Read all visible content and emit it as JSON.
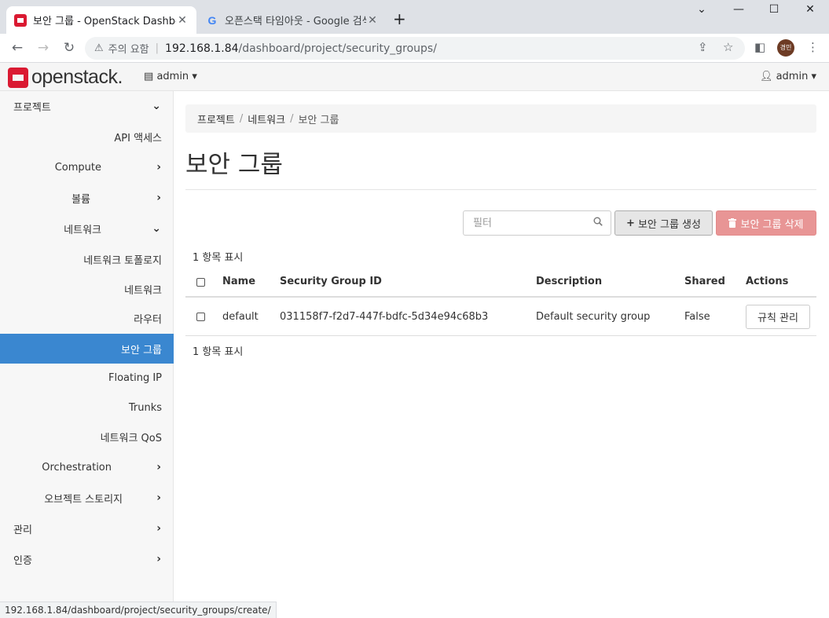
{
  "browser": {
    "tabs": [
      {
        "title": "보안 그룹 - OpenStack Dashboard",
        "active": true
      },
      {
        "title": "오픈스택 타임아웃 - Google 검색",
        "active": false
      }
    ],
    "security_warning": "주의 요함",
    "url_host": "192.168.1.84",
    "url_path": "/dashboard/project/security_groups/",
    "profile_initials": "경민",
    "status_url": "192.168.1.84/dashboard/project/security_groups/create/"
  },
  "header": {
    "logo_text": "openstack.",
    "project_dropdown": "admin",
    "user_dropdown": "admin"
  },
  "sidebar": {
    "items": [
      {
        "label": "프로젝트",
        "chevron": "down"
      },
      {
        "label": "API 액세스",
        "chevron": ""
      },
      {
        "label": "Compute",
        "chevron": "right"
      },
      {
        "label": "볼륨",
        "chevron": "right"
      },
      {
        "label": "네트워크",
        "chevron": "down"
      },
      {
        "label": "네트워크 토폴로지",
        "chevron": ""
      },
      {
        "label": "네트워크",
        "chevron": ""
      },
      {
        "label": "라우터",
        "chevron": ""
      },
      {
        "label": "보안 그룹",
        "chevron": "",
        "active": true
      },
      {
        "label": "Floating IP",
        "chevron": ""
      },
      {
        "label": "Trunks",
        "chevron": ""
      },
      {
        "label": "네트워크 QoS",
        "chevron": ""
      },
      {
        "label": "Orchestration",
        "chevron": "right"
      },
      {
        "label": "오브젝트 스토리지",
        "chevron": "right"
      },
      {
        "label": "관리",
        "chevron": "right"
      },
      {
        "label": "인증",
        "chevron": "right"
      }
    ]
  },
  "breadcrumb": {
    "items": [
      "프로젝트",
      "네트워크",
      "보안 그룹"
    ]
  },
  "page": {
    "title": "보안 그룹",
    "filter_placeholder": "필터",
    "create_button": "보안 그룹 생성",
    "delete_button": "보안 그룹 삭제",
    "count_top": "1 항목 표시",
    "count_bottom": "1 항목 표시"
  },
  "table": {
    "columns": [
      "Name",
      "Security Group ID",
      "Description",
      "Shared",
      "Actions"
    ],
    "rows": [
      {
        "name": "default",
        "id": "031158f7-f2d7-447f-bdfc-5d34e94c68b3",
        "description": "Default security group",
        "shared": "False",
        "action": "규칙 관리"
      }
    ]
  },
  "colors": {
    "accent": "#3a87d0",
    "danger": "#e89595",
    "brand": "#da1a32"
  }
}
